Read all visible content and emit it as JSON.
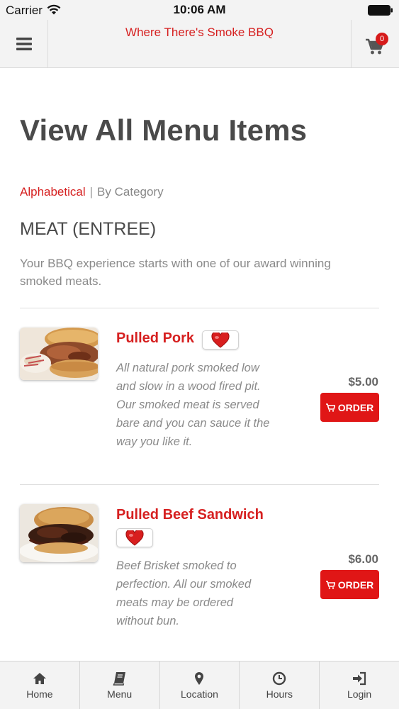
{
  "status_bar": {
    "carrier": "Carrier",
    "time": "10:06 AM"
  },
  "header": {
    "title": "Where There's Smoke BBQ",
    "cart_count": "0"
  },
  "main": {
    "title": "View All Menu Items",
    "sort": {
      "alphabetical": "Alphabetical",
      "separator": "|",
      "by_category": "By Category"
    },
    "section": {
      "title": "MEAT (ENTREE)",
      "description": "Your BBQ experience starts with one of our award winning smoked meats."
    },
    "items": [
      {
        "name": "Pulled Pork",
        "description": "All natural pork smoked low and slow in a wood fired pit. Our smoked meat is served bare and you can sauce it the way you like it.",
        "price": "$5.00",
        "order_label": "ORDER"
      },
      {
        "name": "Pulled Beef Sandwich",
        "description": "Beef Brisket smoked to perfection. All our smoked meats may be ordered without bun.",
        "price": "$6.00",
        "order_label": "ORDER"
      }
    ]
  },
  "tabs": [
    {
      "label": "Home",
      "icon": "home-icon"
    },
    {
      "label": "Menu",
      "icon": "book-icon"
    },
    {
      "label": "Location",
      "icon": "map-pin-icon"
    },
    {
      "label": "Hours",
      "icon": "clock-icon"
    },
    {
      "label": "Login",
      "icon": "login-icon"
    }
  ],
  "colors": {
    "accent": "#d62020",
    "order_button": "#e01616",
    "bar_bg": "#f3f3f3"
  }
}
